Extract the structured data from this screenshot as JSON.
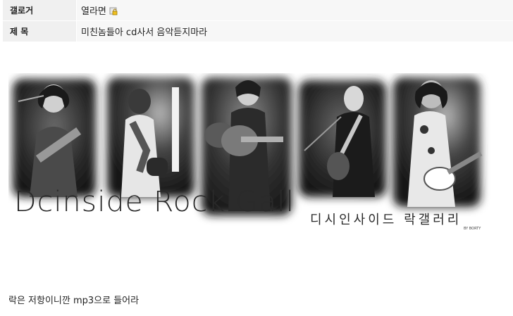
{
  "header": {
    "gallery_label": "갤로거",
    "gallery_value": "열라면",
    "title_label": "제 목",
    "title_value": "미친놈들아 cd사서 음악듣지마라"
  },
  "banner": {
    "logo_text": "Dcinside Rock Gall",
    "korean_text": "디시인사이드 락갤러리",
    "signature": "BY BORTY"
  },
  "post": {
    "body": "락은 저항이니깐 mp3으로 들어라"
  },
  "icons": {
    "lock": "lock-icon"
  }
}
